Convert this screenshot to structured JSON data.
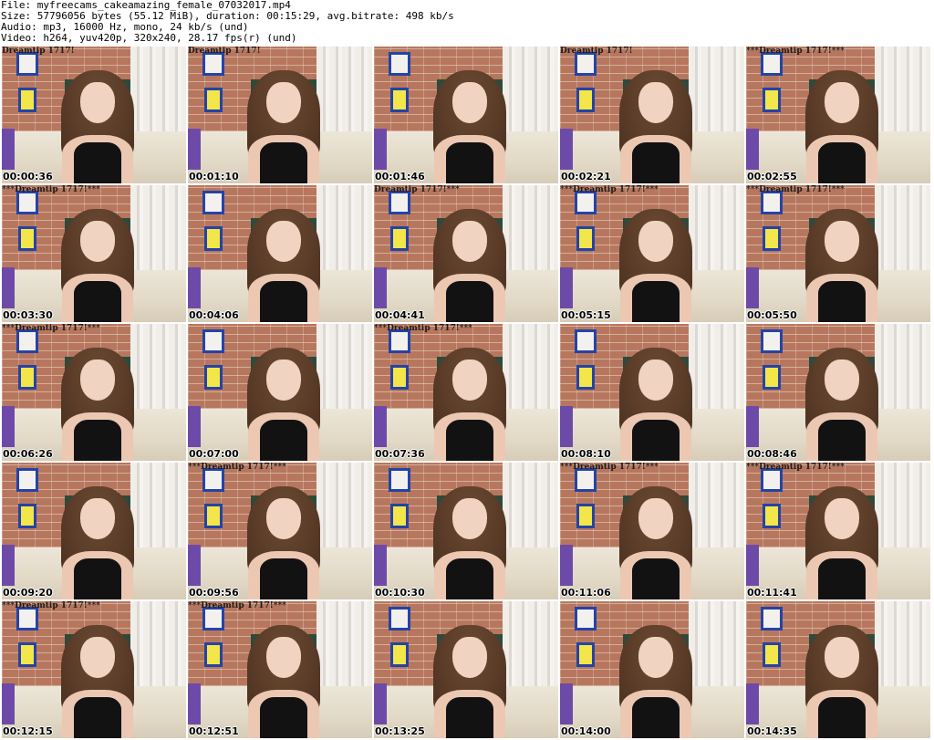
{
  "header": {
    "file_line": "File: myfreecams_cakeamazing_female_07032017.mp4",
    "size_line": "Size: 57796056 bytes (55.12 MiB), duration: 00:15:29, avg.bitrate: 498 kb/s",
    "audio_line": "Audio: mp3, 16000 Hz, mono, 24 kb/s (und)",
    "video_line": "Video: h264, yuv420p, 320x240, 28.17 fps(r) (und)"
  },
  "thumbnails": [
    {
      "timestamp": "00:00:36",
      "overlay": "Dreamtip 1717!"
    },
    {
      "timestamp": "00:01:10",
      "overlay": "Dreamtip 1717!"
    },
    {
      "timestamp": "00:01:46",
      "overlay": ""
    },
    {
      "timestamp": "00:02:21",
      "overlay": "Dreamtip 1717!"
    },
    {
      "timestamp": "00:02:55",
      "overlay": "***Dreamtip 1717!***"
    },
    {
      "timestamp": "00:03:30",
      "overlay": "***Dreamtip 1717!***"
    },
    {
      "timestamp": "00:04:06",
      "overlay": ""
    },
    {
      "timestamp": "00:04:41",
      "overlay": "Dreamtip 1717!***"
    },
    {
      "timestamp": "00:05:15",
      "overlay": "***Dreamtip 1717!***"
    },
    {
      "timestamp": "00:05:50",
      "overlay": "***Dreamtip 1717!***"
    },
    {
      "timestamp": "00:06:26",
      "overlay": "***Dreamtip 1717!***"
    },
    {
      "timestamp": "00:07:00",
      "overlay": ""
    },
    {
      "timestamp": "00:07:36",
      "overlay": "***Dreamtip 1717!***"
    },
    {
      "timestamp": "00:08:10",
      "overlay": ""
    },
    {
      "timestamp": "00:08:46",
      "overlay": ""
    },
    {
      "timestamp": "00:09:20",
      "overlay": ""
    },
    {
      "timestamp": "00:09:56",
      "overlay": "***Dreamtip 1717!***"
    },
    {
      "timestamp": "00:10:30",
      "overlay": ""
    },
    {
      "timestamp": "00:11:06",
      "overlay": "***Dreamtip 1717!***"
    },
    {
      "timestamp": "00:11:41",
      "overlay": "***Dreamtip 1717!***"
    },
    {
      "timestamp": "00:12:15",
      "overlay": "***Dreamtip 1717!***"
    },
    {
      "timestamp": "00:12:51",
      "overlay": "***Dreamtip 1717!***"
    },
    {
      "timestamp": "00:13:25",
      "overlay": ""
    },
    {
      "timestamp": "00:14:00",
      "overlay": ""
    },
    {
      "timestamp": "00:14:35",
      "overlay": ""
    }
  ]
}
